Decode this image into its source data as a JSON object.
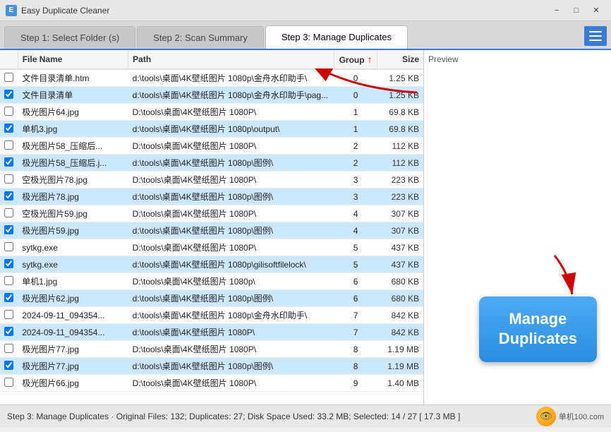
{
  "titleBar": {
    "icon": "E",
    "title": "Easy Duplicate Cleaner",
    "minimizeLabel": "−",
    "maximizeLabel": "□",
    "closeLabel": "✕"
  },
  "tabs": [
    {
      "id": "step1",
      "label": "Step 1: Select Folder (s)",
      "active": false
    },
    {
      "id": "step2",
      "label": "Step 2: Scan Summary",
      "active": false
    },
    {
      "id": "step3",
      "label": "Step 3: Manage Duplicates",
      "active": true
    }
  ],
  "table": {
    "headers": [
      {
        "id": "check",
        "label": ""
      },
      {
        "id": "name",
        "label": "File Name"
      },
      {
        "id": "path",
        "label": "Path"
      },
      {
        "id": "group",
        "label": "Group"
      },
      {
        "id": "size",
        "label": "Size"
      }
    ],
    "rows": [
      {
        "checked": false,
        "name": "文件目录清单.htm",
        "path": "d:\\tools\\桌面\\4K壁纸图片 1080p\\金舟水印助手\\",
        "group": "0",
        "size": "1.25 KB",
        "highlight": false
      },
      {
        "checked": true,
        "name": "文件目录清单",
        "path": "d:\\tools\\桌面\\4K壁纸图片 1080p\\金舟水印助手\\pag...",
        "group": "0",
        "size": "1.25 KB",
        "highlight": true
      },
      {
        "checked": false,
        "name": "极光图片64.jpg",
        "path": "D:\\tools\\桌面\\4K壁纸图片 1080P\\",
        "group": "1",
        "size": "69.8 KB",
        "highlight": false
      },
      {
        "checked": true,
        "name": "单机3.jpg",
        "path": "d:\\tools\\桌面\\4K壁纸图片 1080p\\output\\",
        "group": "1",
        "size": "69.8 KB",
        "highlight": true
      },
      {
        "checked": false,
        "name": "极光图片58_压缩后...",
        "path": "D:\\tools\\桌面\\4K壁纸图片 1080P\\",
        "group": "2",
        "size": "112 KB",
        "highlight": false
      },
      {
        "checked": true,
        "name": "极光图片58_压缩后.j...",
        "path": "d:\\tools\\桌面\\4K壁纸图片 1080p\\图例\\",
        "group": "2",
        "size": "112 KB",
        "highlight": true
      },
      {
        "checked": false,
        "name": "空极光图片78.jpg",
        "path": "D:\\tools\\桌面\\4K壁纸图片 1080P\\",
        "group": "3",
        "size": "223 KB",
        "highlight": false
      },
      {
        "checked": true,
        "name": "极光图片78.jpg",
        "path": "d:\\tools\\桌面\\4K壁纸图片 1080p\\图例\\",
        "group": "3",
        "size": "223 KB",
        "highlight": true
      },
      {
        "checked": false,
        "name": "空极光图片59.jpg",
        "path": "D:\\tools\\桌面\\4K壁纸图片 1080P\\",
        "group": "4",
        "size": "307 KB",
        "highlight": false
      },
      {
        "checked": true,
        "name": "极光图片59.jpg",
        "path": "d:\\tools\\桌面\\4K壁纸图片 1080p\\图例\\",
        "group": "4",
        "size": "307 KB",
        "highlight": true
      },
      {
        "checked": false,
        "name": "sytkg.exe",
        "path": "D:\\tools\\桌面\\4K壁纸图片 1080P\\",
        "group": "5",
        "size": "437 KB",
        "highlight": false
      },
      {
        "checked": true,
        "name": "sytkg.exe",
        "path": "d:\\tools\\桌面\\4K壁纸图片 1080p\\gilisoftfilelock\\",
        "group": "5",
        "size": "437 KB",
        "highlight": true
      },
      {
        "checked": false,
        "name": "单机1.jpg",
        "path": "D:\\tools\\桌面\\4K壁纸图片 1080p\\",
        "group": "6",
        "size": "680 KB",
        "highlight": false
      },
      {
        "checked": true,
        "name": "极光图片62.jpg",
        "path": "d:\\tools\\桌面\\4K壁纸图片 1080p\\图例\\",
        "group": "6",
        "size": "680 KB",
        "highlight": true
      },
      {
        "checked": false,
        "name": "2024-09-11_094354...",
        "path": "d:\\tools\\桌面\\4K壁纸图片 1080p\\金舟水印助手\\",
        "group": "7",
        "size": "842 KB",
        "highlight": false
      },
      {
        "checked": true,
        "name": "2024-09-11_094354...",
        "path": "d:\\tools\\桌面\\4K壁纸图片 1080P\\",
        "group": "7",
        "size": "842 KB",
        "highlight": true
      },
      {
        "checked": false,
        "name": "极光图片77.jpg",
        "path": "D:\\tools\\桌面\\4K壁纸图片 1080P\\",
        "group": "8",
        "size": "1.19 MB",
        "highlight": false
      },
      {
        "checked": true,
        "name": "极光图片77.jpg",
        "path": "d:\\tools\\桌面\\4K壁纸图片 1080p\\图例\\",
        "group": "8",
        "size": "1.19 MB",
        "highlight": true
      },
      {
        "checked": false,
        "name": "极光图片66.jpg",
        "path": "D:\\tools\\桌面\\4K壁纸图片 1080P\\",
        "group": "9",
        "size": "1.40 MB",
        "highlight": false
      }
    ]
  },
  "preview": {
    "label": "Preview"
  },
  "manageBtn": {
    "line1": "Manage",
    "line2": "Duplicates"
  },
  "statusBar": {
    "text": "Step 3: Manage Duplicates  ·  Original Files: 132;   Duplicates: 27;   Disk Space Used: 33.2 MB;   Selected: 14 / 27   [ 17.3 MB ]",
    "logoText": "单机100.com",
    "logoIcon": "👁"
  }
}
